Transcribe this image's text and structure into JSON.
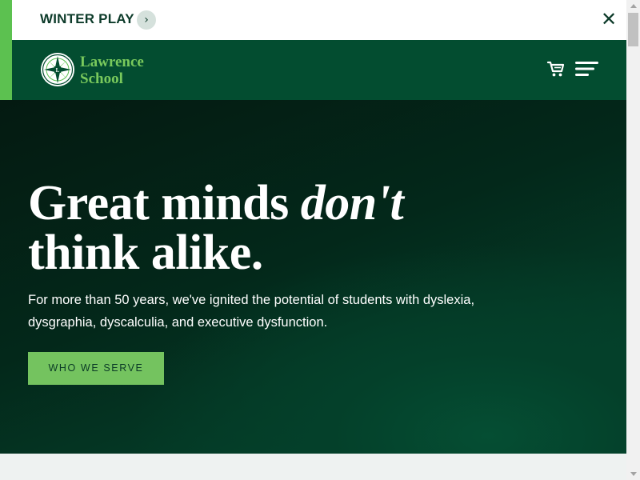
{
  "alert": {
    "text": "WINTER PLAY",
    "arrow_icon": "chevron-right-icon",
    "arrow_glyph": "›",
    "close_icon": "close-icon",
    "close_glyph": "✕"
  },
  "header": {
    "logo_line1": "Lawrence",
    "logo_line2": "School",
    "logo_alt": "Lawrence School",
    "cart_icon": "cart-icon",
    "menu_icon": "menu-icon"
  },
  "hero": {
    "heading_part1": "Great minds ",
    "heading_emphasis": "don't",
    "heading_line2": "think alike.",
    "body": "For more than 50 years, we've ignited the potential of students with dyslexia, dysgraphia, dyscalculia, and executive dysfunction.",
    "cta_label": "WHO WE SERVE"
  },
  "colors": {
    "brand_dark_green": "#034d30",
    "brand_light_green": "#74c35f",
    "accent_strip": "#5cc150",
    "logo_text": "#79c95c",
    "alert_text": "#0d3b2a"
  }
}
